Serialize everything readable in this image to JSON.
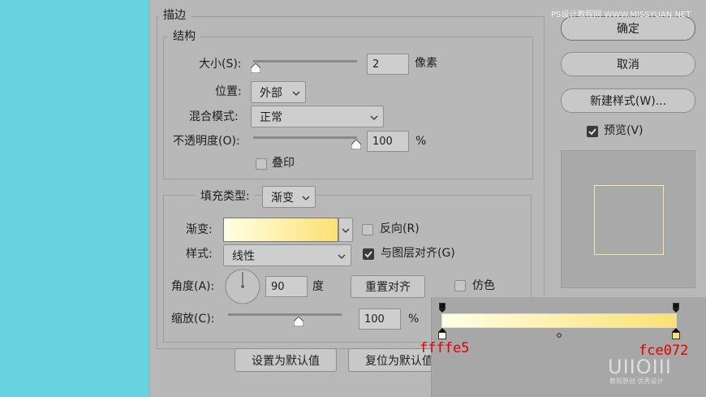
{
  "stroke": {
    "title": "描边",
    "structure": {
      "title": "结构",
      "size_label": "大小(S):",
      "size_value": "2",
      "size_unit": "像素",
      "size_slider_fraction": 0.0,
      "position_label": "位置:",
      "position_value": "外部",
      "blend_label": "混合模式:",
      "blend_value": "正常",
      "opacity_label": "不透明度(O):",
      "opacity_value": "100",
      "opacity_unit": "%",
      "opacity_slider_fraction": 1.0,
      "overprint_label": "叠印",
      "overprint_checked": false
    },
    "fill": {
      "type_label": "填充类型:",
      "type_value": "渐变",
      "gradient_label": "渐变:",
      "reverse_label": "反向(R)",
      "reverse_checked": false,
      "style_label": "样式:",
      "style_value": "线性",
      "align_label": "与图层对齐(G)",
      "align_checked": true,
      "angle_label": "角度(A):",
      "angle_value": "90",
      "angle_unit": "度",
      "reset_align_button": "重置对齐",
      "dither_label": "仿色",
      "dither_checked": false,
      "scale_label": "缩放(C):",
      "scale_value": "100",
      "scale_unit": "%",
      "scale_slider_fraction": 0.6
    }
  },
  "bottom_buttons": {
    "set_default": "设置为默认值",
    "reset_default": "复位为默认值"
  },
  "side": {
    "ok": "确定",
    "cancel": "取消",
    "new_style": "新建样式(W)...",
    "preview_label": "预览(V)",
    "preview_checked": true
  },
  "gradient_popup": {
    "start_color_label": "ffffe5",
    "end_color_label": "fce072",
    "start_color": "#ffffe5",
    "end_color": "#fce072"
  },
  "watermark": {
    "top": "PS设计教程网 WWW.MISSYUAN.NET",
    "brand": "UIIOIII",
    "brand_sub": "教程原创 优秀设计"
  }
}
